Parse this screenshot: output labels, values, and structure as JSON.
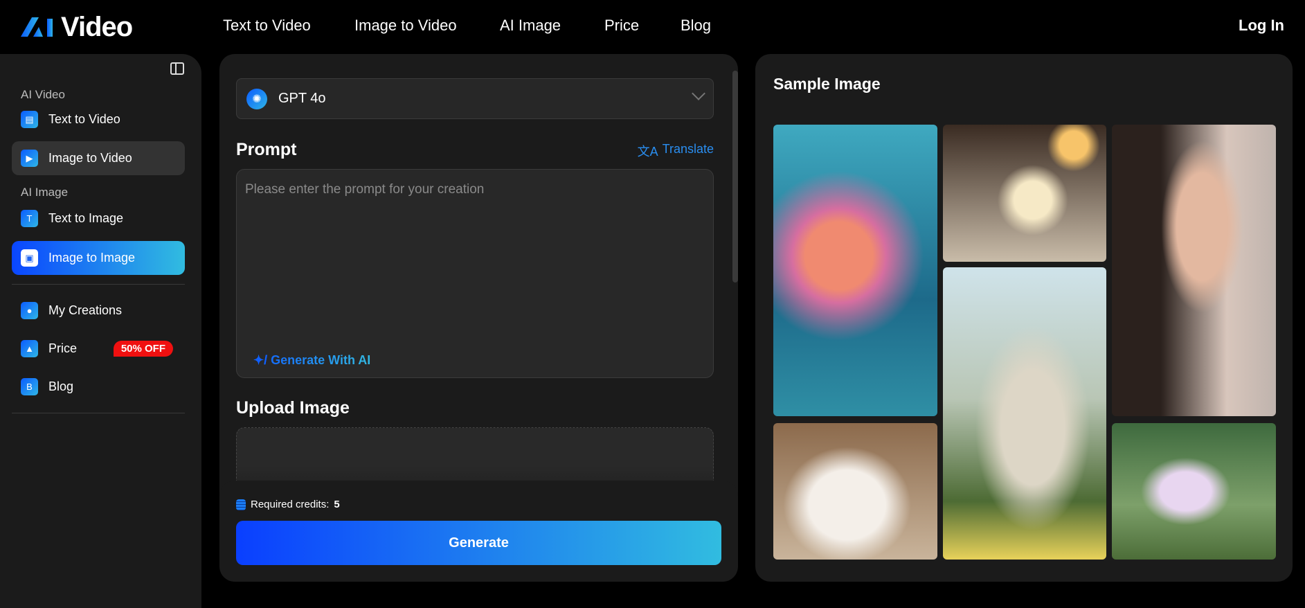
{
  "header": {
    "logo_ai": "AI",
    "logo_text": "Video",
    "nav": [
      "Text to Video",
      "Image to Video",
      "AI Image",
      "Price",
      "Blog"
    ],
    "login": "Log In"
  },
  "sidebar": {
    "section_video": "AI Video",
    "section_image": "AI Image",
    "items": [
      {
        "label": "Text to Video"
      },
      {
        "label": "Image to Video"
      },
      {
        "label": "Text to Image"
      },
      {
        "label": "Image to Image"
      },
      {
        "label": "My Creations"
      },
      {
        "label": "Price"
      },
      {
        "label": "Blog"
      }
    ],
    "price_badge": "50% OFF"
  },
  "form": {
    "model": "GPT 4o",
    "prompt_title": "Prompt",
    "translate": "Translate",
    "prompt_placeholder": "Please enter the prompt for your creation",
    "generate_with_ai": "Generate With AI",
    "upload_title": "Upload Image",
    "credits_label": "Required credits:",
    "credits_value": "5",
    "generate": "Generate"
  },
  "samples": {
    "title": "Sample Image",
    "images": [
      "sea anemone",
      "ice cream dessert",
      "woman portrait",
      "sheep",
      "ragdoll cat",
      "balloon castle"
    ]
  },
  "colors": {
    "accent_start": "#0a46ff",
    "accent_end": "#31bce0",
    "badge": "#f01010"
  }
}
